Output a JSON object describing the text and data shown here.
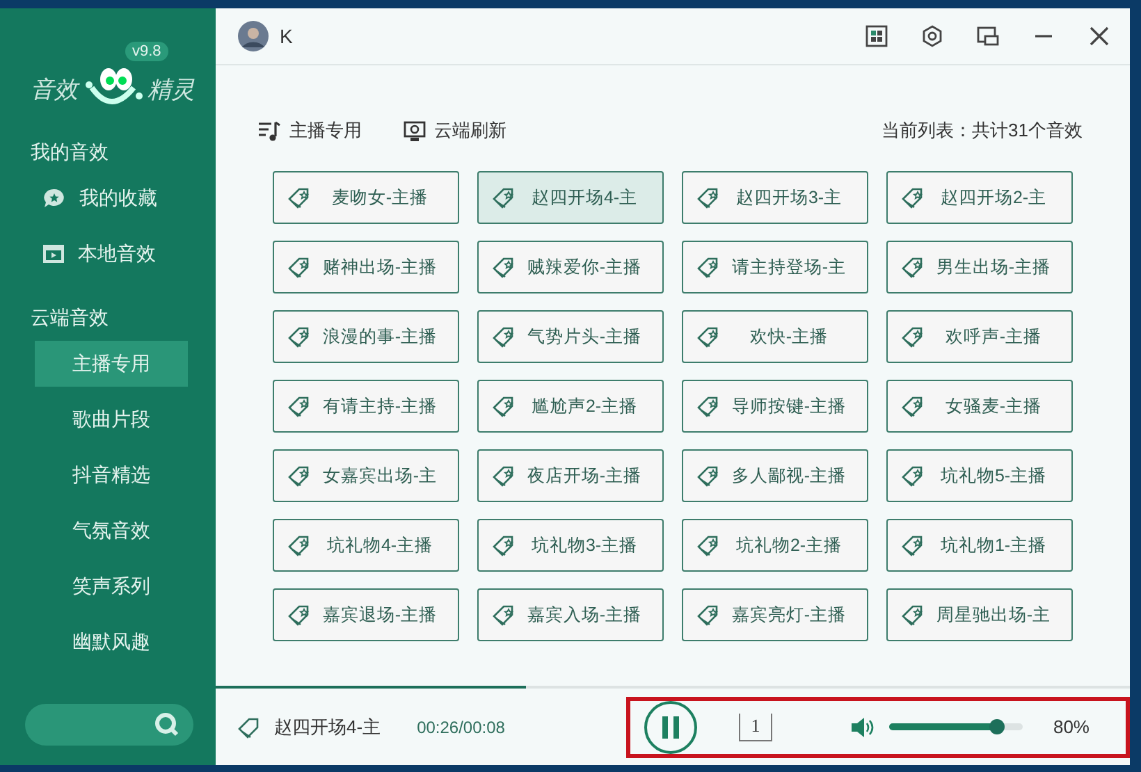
{
  "logo": {
    "left": "音效",
    "right": "精灵",
    "version": "v9.8"
  },
  "sidebar": {
    "sections": [
      {
        "title": "我的音效",
        "items": [
          {
            "label": "我的收藏",
            "kind": "favorite",
            "selected": false
          },
          {
            "label": "本地音效",
            "kind": "local",
            "selected": false
          }
        ]
      },
      {
        "title": "云端音效",
        "items": [
          {
            "label": "主播专用",
            "selected": true
          },
          {
            "label": "歌曲片段",
            "selected": false
          },
          {
            "label": "抖音精选",
            "selected": false
          },
          {
            "label": "气氛音效",
            "selected": false
          },
          {
            "label": "笑声系列",
            "selected": false
          },
          {
            "label": "幽默风趣",
            "selected": false
          }
        ]
      }
    ]
  },
  "user": {
    "name": "K"
  },
  "toolbar": {
    "category": "主播专用",
    "refresh": "云端刷新",
    "summary": "当前列表：共计31个音效"
  },
  "sounds": [
    {
      "label": "麦吻女-主播",
      "selected": false
    },
    {
      "label": "赵四开场4-主",
      "selected": true
    },
    {
      "label": "赵四开场3-主",
      "selected": false
    },
    {
      "label": "赵四开场2-主",
      "selected": false
    },
    {
      "label": "赌神出场-主播",
      "selected": false
    },
    {
      "label": "贼辣爱你-主播",
      "selected": false
    },
    {
      "label": "请主持登场-主",
      "selected": false
    },
    {
      "label": "男生出场-主播",
      "selected": false
    },
    {
      "label": "浪漫的事-主播",
      "selected": false
    },
    {
      "label": "气势片头-主播",
      "selected": false
    },
    {
      "label": "欢快-主播",
      "selected": false
    },
    {
      "label": "欢呼声-主播",
      "selected": false
    },
    {
      "label": "有请主持-主播",
      "selected": false
    },
    {
      "label": "尴尬声2-主播",
      "selected": false
    },
    {
      "label": "导师按键-主播",
      "selected": false
    },
    {
      "label": "女骚麦-主播",
      "selected": false
    },
    {
      "label": "女嘉宾出场-主",
      "selected": false
    },
    {
      "label": "夜店开场-主播",
      "selected": false
    },
    {
      "label": "多人鄙视-主播",
      "selected": false
    },
    {
      "label": "坑礼物5-主播",
      "selected": false
    },
    {
      "label": "坑礼物4-主播",
      "selected": false
    },
    {
      "label": "坑礼物3-主播",
      "selected": false
    },
    {
      "label": "坑礼物2-主播",
      "selected": false
    },
    {
      "label": "坑礼物1-主播",
      "selected": false
    },
    {
      "label": "嘉宾退场-主播",
      "selected": false
    },
    {
      "label": "嘉宾入场-主播",
      "selected": false
    },
    {
      "label": "嘉宾亮灯-主播",
      "selected": false
    },
    {
      "label": "周星驰出场-主",
      "selected": false
    }
  ],
  "player": {
    "title": "赵四开场4-主",
    "time": "00:26/00:08",
    "progress": {
      "level": 0.34
    },
    "playing": true,
    "repeat_count": "1",
    "volume": {
      "level": 0.8
    },
    "volume_text": "80%",
    "highlighted": true
  }
}
